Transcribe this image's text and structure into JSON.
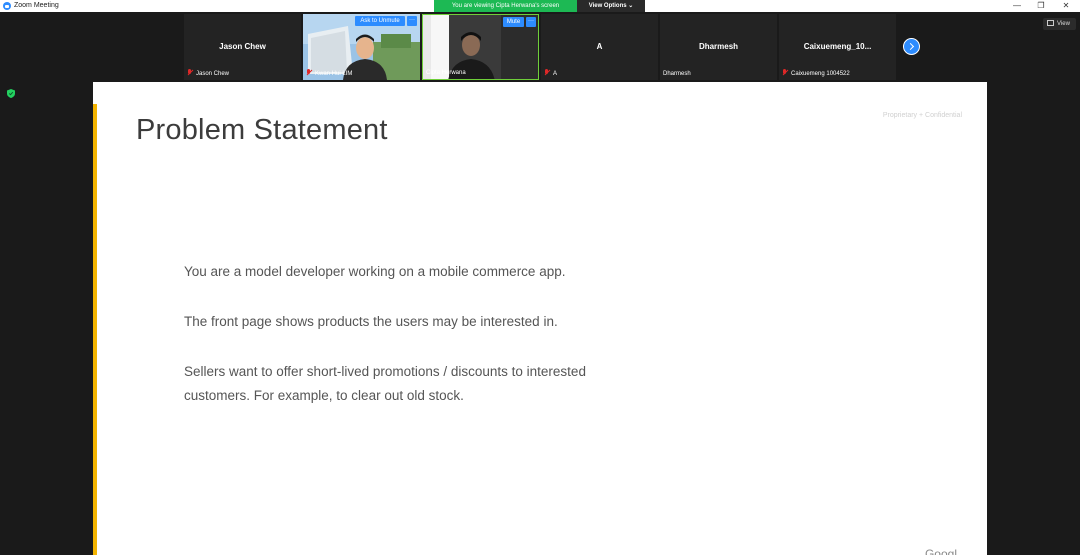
{
  "window": {
    "title": "Zoom Meeting",
    "controls": [
      "—",
      "❐",
      "✕"
    ]
  },
  "banner": {
    "viewing_text": "You are viewing Cipta Herwana's screen",
    "view_options_label": "View Options ⌄"
  },
  "view_button": {
    "label": "View"
  },
  "participants": [
    {
      "display": "Jason Chew",
      "caption": "Jason Chew",
      "muted": true,
      "video": false
    },
    {
      "display": "",
      "caption": "Kwan Hui LIM",
      "muted": true,
      "video": true,
      "action": "Ask to Unmute",
      "more": "···"
    },
    {
      "display": "",
      "caption": "Cipta Herwana",
      "muted": false,
      "video": true,
      "action": "Mute",
      "more": "···"
    },
    {
      "display": "A",
      "caption": "A",
      "muted": true,
      "video": false
    },
    {
      "display": "Dharmesh",
      "caption": "Dharmesh",
      "muted": false,
      "video": false
    },
    {
      "display": "Caixuemeng_10...",
      "caption": "Caixuemeng 1004522",
      "muted": true,
      "video": false
    }
  ],
  "slide": {
    "title": "Problem Statement",
    "confidential": "Proprietary + Confidential",
    "paragraphs": [
      "You are a model developer working on a mobile commerce app.",
      "The front page shows products the users may be interested in.",
      "Sellers want to offer short-lived promotions / discounts to interested customers. For example, to clear out old stock."
    ],
    "corner_text": "Googl"
  },
  "colors": {
    "accent": "#f4b400",
    "zoom_blue": "#2d8cff",
    "banner_green": "#1db954"
  }
}
